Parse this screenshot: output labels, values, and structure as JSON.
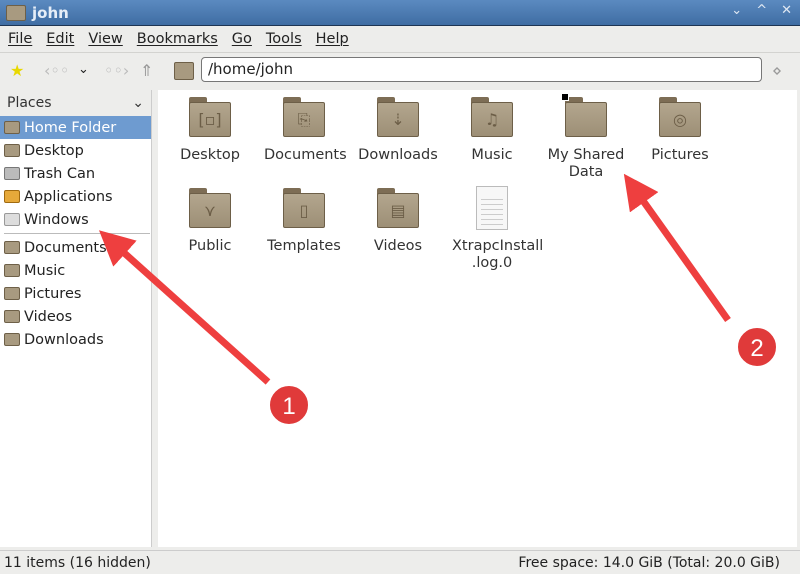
{
  "window": {
    "title": "john",
    "controls": [
      "⌄",
      "^",
      "✕"
    ]
  },
  "menu": [
    "File",
    "Edit",
    "View",
    "Bookmarks",
    "Go",
    "Tools",
    "Help"
  ],
  "toolbar": {
    "path": "/home/john"
  },
  "sidebar": {
    "header": "Places",
    "items": [
      "Home Folder",
      "Desktop",
      "Trash Can",
      "Applications",
      "Windows"
    ],
    "bookmarks": [
      "Documents",
      "Music",
      "Pictures",
      "Videos",
      "Downloads"
    ]
  },
  "files": [
    {
      "name": "Desktop",
      "glyph": "[▫]"
    },
    {
      "name": "Documents",
      "glyph": "⎘"
    },
    {
      "name": "Downloads",
      "glyph": "⇣"
    },
    {
      "name": "Music",
      "glyph": "♫"
    },
    {
      "name": "My Shared Data",
      "glyph": ""
    },
    {
      "name": "Pictures",
      "glyph": "◎"
    },
    {
      "name": "Public",
      "glyph": "⋎"
    },
    {
      "name": "Templates",
      "glyph": "▯"
    },
    {
      "name": "Videos",
      "glyph": "▤"
    },
    {
      "name": "XtrapcInstall .log.0",
      "glyph": ""
    }
  ],
  "status": {
    "left": "11 items (16 hidden)",
    "right": "Free space: 14.0 GiB (Total: 20.0 GiB)"
  },
  "annotations": [
    "1",
    "2"
  ],
  "colors": {
    "accent": "#6e9bd0",
    "arrow": "#ee3f3f"
  }
}
